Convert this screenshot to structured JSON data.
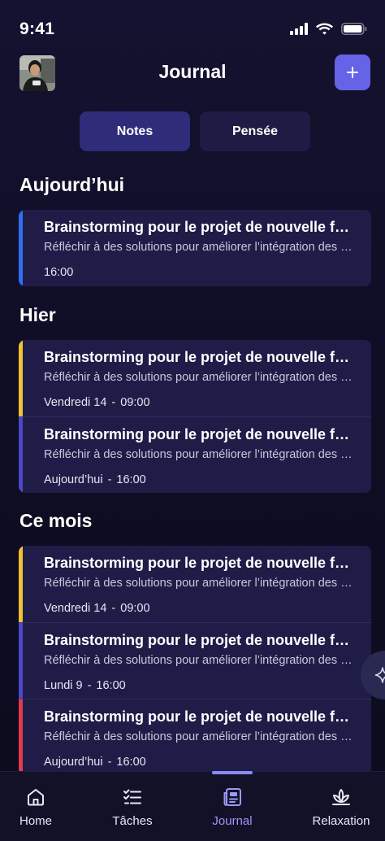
{
  "status_bar": {
    "time": "9:41"
  },
  "header": {
    "title": "Journal",
    "add_label": "+"
  },
  "segments": [
    {
      "label": "Notes",
      "active": true
    },
    {
      "label": "Pensée",
      "active": false
    }
  ],
  "sections": [
    {
      "title": "Aujourd’hui",
      "notes": [
        {
          "title": "Brainstorming pour le projet de nouvelle fonctionnalité",
          "description": "Réfléchir à des solutions pour améliorer l’intégration des utilisateurs",
          "date": "",
          "time": "16:00",
          "accent": "#2f6ef2"
        }
      ]
    },
    {
      "title": "Hier",
      "notes": [
        {
          "title": "Brainstorming pour le projet de nouvelle fonctionnalité",
          "description": "Réfléchir à des solutions pour améliorer l’intégration des utilisateurs",
          "date": "Vendredi 14",
          "time": "09:00",
          "accent": "#f2c230"
        },
        {
          "title": "Brainstorming pour le projet de nouvelle fonctionnalité",
          "description": "Réfléchir à des solutions pour améliorer l’intégration des utilisateurs",
          "date": "Aujourd’hui",
          "time": "16:00",
          "accent": "#4a47c8"
        }
      ]
    },
    {
      "title": "Ce mois",
      "notes": [
        {
          "title": "Brainstorming pour le projet de nouvelle fonctionnalité",
          "description": "Réfléchir à des solutions pour améliorer l’intégration des utilisateurs",
          "date": "Vendredi 14",
          "time": "09:00",
          "accent": "#f2c230"
        },
        {
          "title": "Brainstorming pour le projet de nouvelle fonctionnalité",
          "description": "Réfléchir à des solutions pour améliorer l’intégration des utilisateurs",
          "date": "Lundi 9",
          "time": "16:00",
          "accent": "#4a47c8"
        },
        {
          "title": "Brainstorming pour le projet de nouvelle fonctionnalité",
          "description": "Réfléchir à des solutions pour améliorer l’intégration des utilisateurs",
          "date": "Aujourd’hui",
          "time": "16:00",
          "accent": "#e23a4e"
        }
      ]
    }
  ],
  "nav": [
    {
      "label": "Home",
      "icon": "home-icon",
      "active": false
    },
    {
      "label": "Tâches",
      "icon": "tasks-icon",
      "active": false
    },
    {
      "label": "Journal",
      "icon": "journal-icon",
      "active": true
    },
    {
      "label": "Relaxation",
      "icon": "lotus-icon",
      "active": false
    }
  ],
  "colors": {
    "accent": "#6663e6",
    "card": "#1f1d48",
    "background": "#0f0e24"
  }
}
